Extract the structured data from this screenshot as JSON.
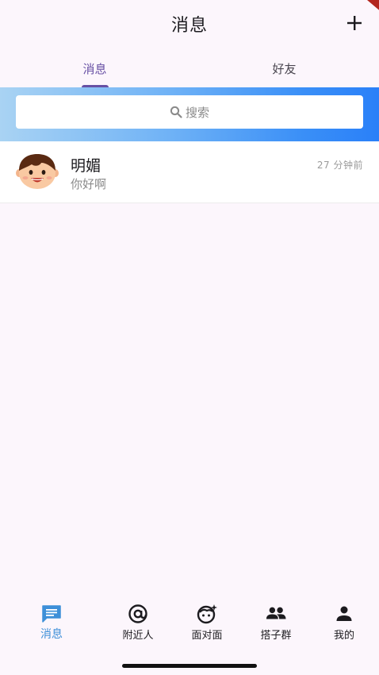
{
  "appbar": {
    "title": "消息",
    "add_icon": "plus-icon"
  },
  "tabs": [
    {
      "label": "消息",
      "active": true
    },
    {
      "label": "好友",
      "active": false
    }
  ],
  "search": {
    "placeholder": "搜索",
    "icon": "search-icon"
  },
  "conversations": [
    {
      "name": "明媚",
      "preview": "你好啊",
      "time": "27 分钟前",
      "avatar_icon": "boy-face-avatar"
    }
  ],
  "bottom_nav": [
    {
      "label": "消息",
      "icon": "chat-icon",
      "active": true
    },
    {
      "label": "附近人",
      "icon": "at-sign-icon",
      "active": false
    },
    {
      "label": "面对面",
      "icon": "face-sparkle-icon",
      "active": false
    },
    {
      "label": "搭子群",
      "icon": "group-icon",
      "active": false
    },
    {
      "label": "我的",
      "icon": "person-icon",
      "active": false
    }
  ],
  "colors": {
    "accent": "#6750a4",
    "nav_active": "#3d8fd8",
    "banner_start": "#a9d3f3",
    "banner_end": "#2a80f8",
    "background": "#fcf6fc"
  }
}
